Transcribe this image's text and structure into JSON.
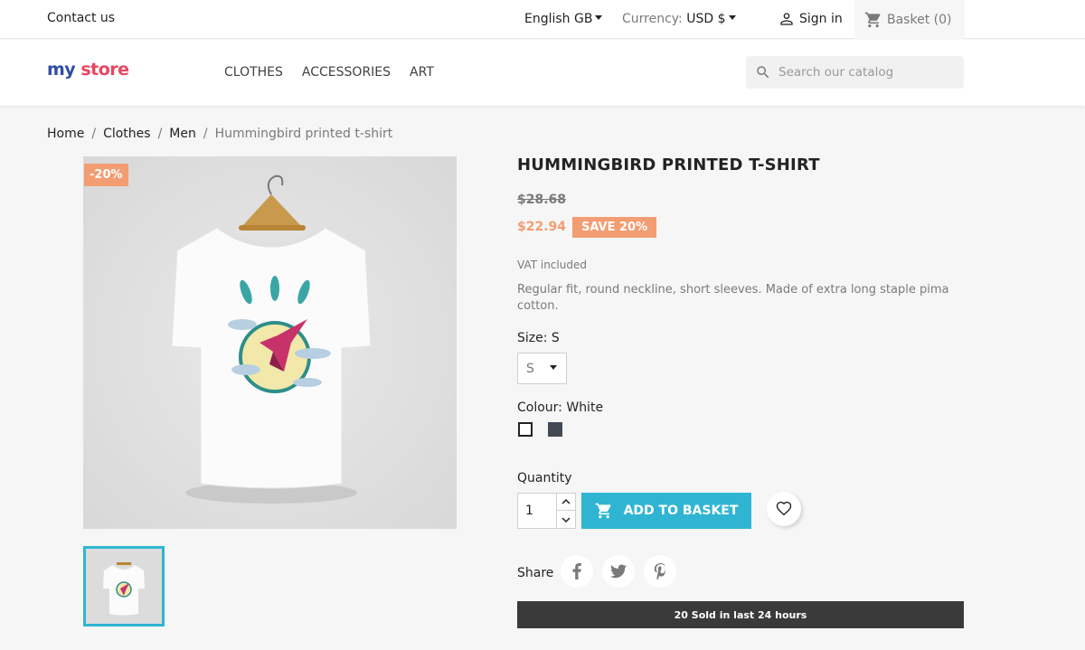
{
  "topbar": {
    "contact": "Contact us",
    "language": "English GB",
    "currency_label": "Currency:",
    "currency_value": "USD $",
    "signin": "Sign in",
    "basket": "Basket (0)"
  },
  "header": {
    "logo_part1": "my",
    "logo_part2": "store",
    "nav": [
      "CLOTHES",
      "ACCESSORIES",
      "ART"
    ],
    "search_placeholder": "Search our catalog"
  },
  "breadcrumb": [
    "Home",
    "Clothes",
    "Men",
    "Hummingbird printed t-shirt"
  ],
  "product": {
    "discount_flag": "-20%",
    "title": "HUMMINGBIRD PRINTED T-SHIRT",
    "old_price": "$28.68",
    "price": "$22.94",
    "save_badge": "SAVE 20%",
    "vat": "VAT included",
    "description": "Regular fit, round neckline, short sleeves. Made of extra long staple pima cotton.",
    "size_label": "Size: S",
    "size_value": "S",
    "colour_label": "Colour: White",
    "colours": [
      "#ffffff",
      "#434a54"
    ],
    "quantity_label": "Quantity",
    "quantity": "1",
    "add_to_basket": "ADD TO BASKET",
    "share_label": "Share",
    "sold_banner": "20 Sold in last 24 hours"
  },
  "colors": {
    "accent": "#2fb5d2",
    "discount": "#f39d72",
    "dark": "#232323"
  }
}
